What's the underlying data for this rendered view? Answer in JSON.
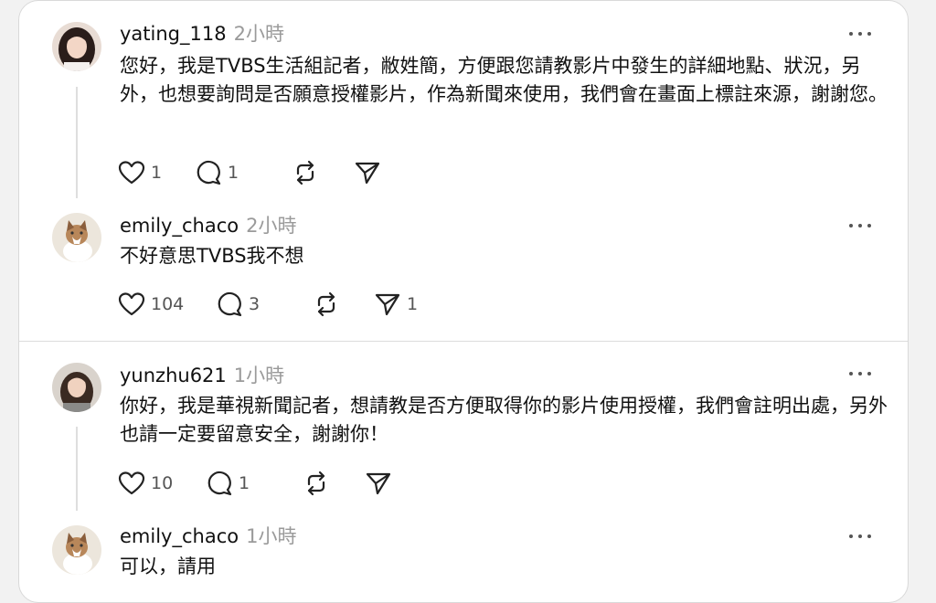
{
  "posts": [
    {
      "username": "yating_118",
      "time": "2小時",
      "text": "您好，我是TVBS生活組記者，敝姓簡，方便跟您請教影片中發生的詳細地點、狀況，另外，也想要詢問是否願意授權影片，作為新聞來使用，我們會在畫面上標註來源，謝謝您。",
      "like_count": "1",
      "reply_count": "1",
      "repost_count": "",
      "share_count": ""
    },
    {
      "username": "emily_chaco",
      "time": "2小時",
      "text": "不好意思TVBS我不想",
      "like_count": "104",
      "reply_count": "3",
      "repost_count": "",
      "share_count": "1"
    },
    {
      "username": "yunzhu621",
      "time": "1小時",
      "text": "你好，我是華視新聞記者，想請教是否方便取得你的影片使用授權，我們會註明出處，另外也請一定要留意安全，謝謝你！",
      "like_count": "10",
      "reply_count": "1",
      "repost_count": "",
      "share_count": ""
    },
    {
      "username": "emily_chaco",
      "time": "1小時",
      "text": "可以，請用"
    }
  ],
  "colors": {
    "text": "#111111",
    "muted": "#9a9a9a",
    "divider": "#dcdcdc",
    "card_bg": "#ffffff",
    "page_bg": "#f2f2f2"
  },
  "icons": [
    "heart-icon",
    "comment-icon",
    "repost-icon",
    "share-icon",
    "more-icon"
  ]
}
